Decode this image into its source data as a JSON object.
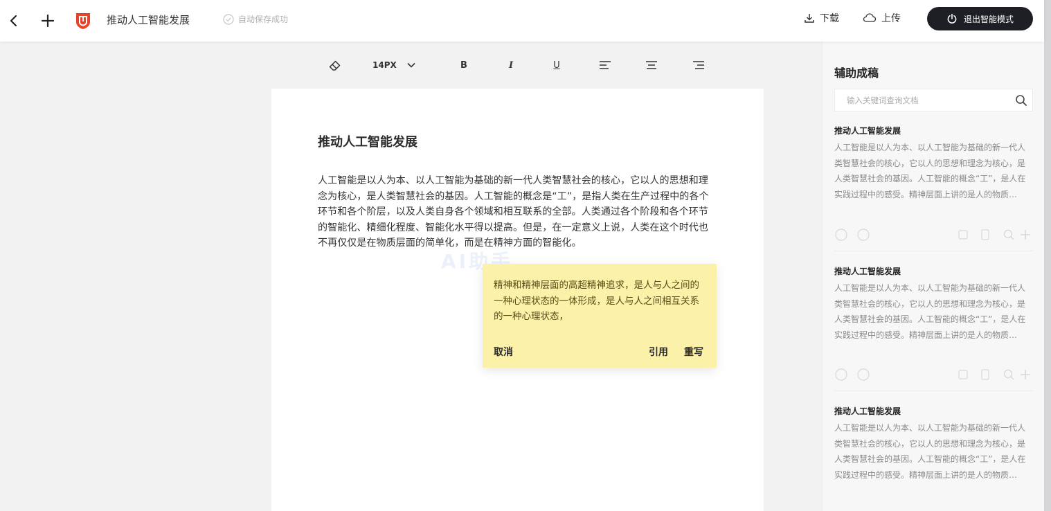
{
  "header": {
    "doc_title": "推动人工智能发展",
    "autosave": "自动保存成功",
    "download_label": "下载",
    "upload_label": "上传",
    "exit_label": "退出智能模式"
  },
  "toolbar": {
    "font_size": "14PX",
    "bold": "B",
    "italic": "I",
    "underline": "U"
  },
  "document": {
    "title": "推动人工智能发展",
    "body": "人工智能是以人为本、以人工智能为基础的新一代人类智慧社会的核心，它以人的思想和理念为核心，是人类智慧社会的基因。人工智能的概念是“工”，是指人类在生产过程中的各个环节和各个阶层，以及人类自身各个领域和相互联系的全部。人类通过各个阶段和各个环节的智能化、精细化程度、智能化水平得以提高。但是，在一定意义上说，人类在这个时代也不再仅仅是在物质层面的简单化，而是在精神方面的智能化。",
    "watermark": "AI助手"
  },
  "suggestion": {
    "text": "精神和精神层面的高超精神追求，是人与人之间的一种心理状态的一体形成，是人与人之间相互关系的一种心理状态，",
    "cancel_label": "取消",
    "cite_label": "引用",
    "rewrite_label": "重写"
  },
  "sidebar": {
    "title": "辅助成稿",
    "search_placeholder": "输入关键词查询文档",
    "cards": [
      {
        "title": "推动人工智能发展",
        "text": "人工智能是以人为本、以人工智能为基础的新一代人类智慧社会的核心，它以人的思想和理念为核心，是人类智慧社会的基因。人工智能的概念“工”，是人在实践过程中的感受。精神层面上讲的是人的物质…"
      },
      {
        "title": "推动人工智能发展",
        "text": "人工智能是以人为本、以人工智能为基础的新一代人类智慧社会的核心，它以人的思想和理念为核心，是人类智慧社会的基因。人工智能的概念“工”，是人在实践过程中的感受。精神层面上讲的是人的物质…"
      },
      {
        "title": "推动人工智能发展",
        "text": "人工智能是以人为本、以人工智能为基础的新一代人类智慧社会的核心，它以人的思想和理念为核心，是人类智慧社会的基因。人工智能的概念“工”，是人在实践过程中的感受。精神层面上讲的是人的物质…"
      }
    ]
  },
  "colors": {
    "accent_logo": "#e8432a",
    "exit_button_bg": "#1d1f24",
    "suggestion_bg": "#fbf1a8"
  }
}
